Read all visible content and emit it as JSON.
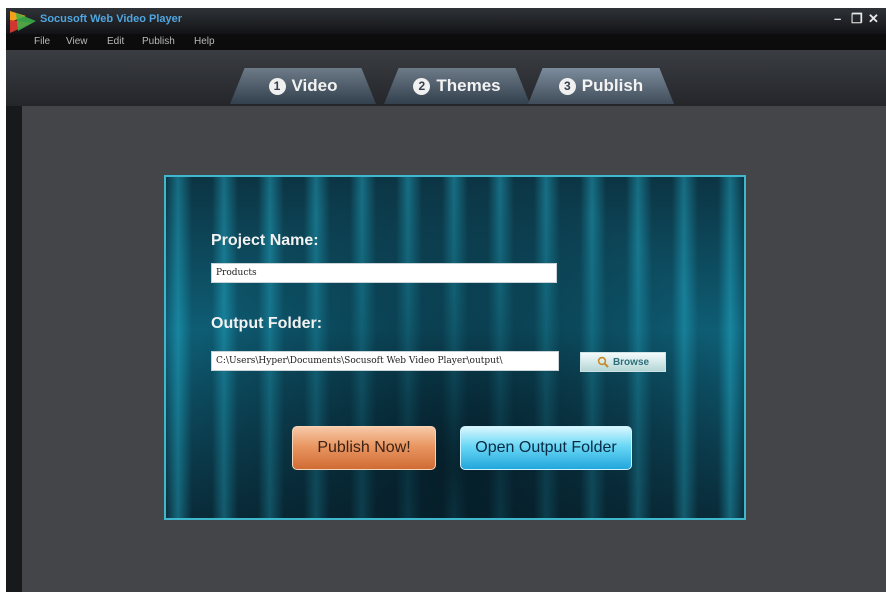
{
  "window": {
    "title": "Socusoft Web Video Player",
    "controls": [
      "–",
      "❐",
      "✕"
    ]
  },
  "menu": [
    "File",
    "View",
    "Edit",
    "Publish",
    "Help"
  ],
  "tabs": [
    {
      "num": "1",
      "label": "Video"
    },
    {
      "num": "2",
      "label": "Themes"
    },
    {
      "num": "3",
      "label": "Publish"
    }
  ],
  "form": {
    "project_label": "Project Name:",
    "project_value": "Products",
    "output_label": "Output Folder:",
    "output_value": "C:\\Users\\Hyper\\Documents\\Socusoft Web Video Player\\output\\",
    "browse_label": "Browse",
    "publish_label": "Publish Now!",
    "open_label": "Open Output Folder"
  },
  "icons": {
    "app_logo": "app-logo-icon",
    "browse": "magnifier-icon"
  },
  "colors": {
    "accent": "#3fb7cc",
    "publish": "#e99762",
    "open": "#22a6dc"
  }
}
